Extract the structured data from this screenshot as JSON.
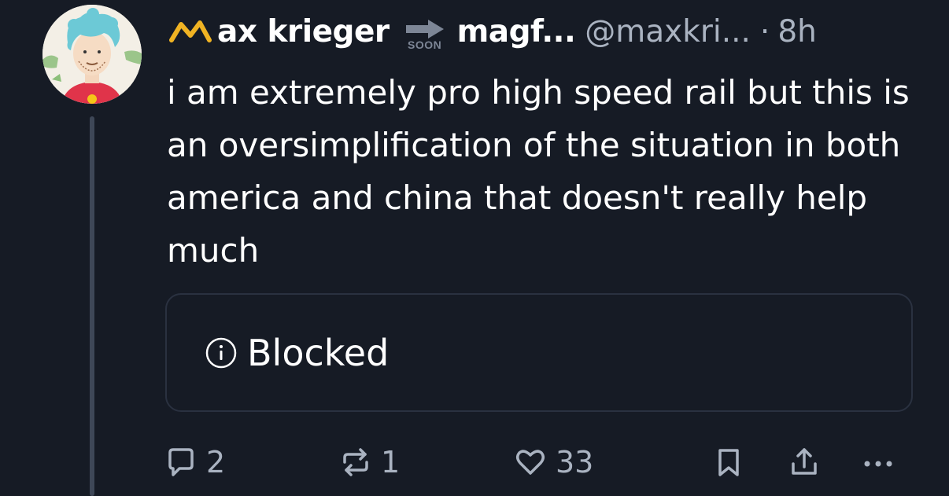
{
  "author": {
    "display_name": "ax krieger",
    "badge_text": "SOON",
    "second_name": "magf...",
    "handle": "@maxkri...",
    "separator": "·",
    "time_ago": "8h"
  },
  "post": {
    "text": "i am extremely pro high speed rail but this is an oversimplification of the situation in both america and china that doesn't really help much"
  },
  "embed": {
    "label": "Blocked",
    "icon": "info-icon"
  },
  "actions": {
    "reply_count": "2",
    "repost_count": "1",
    "like_count": "33"
  },
  "colors": {
    "background": "#161b25",
    "text_primary": "#ffffff",
    "text_secondary": "#aab3c1",
    "thread_line": "#3e4757",
    "card_border": "#2a3140",
    "emoji_m": "#f0b323"
  }
}
